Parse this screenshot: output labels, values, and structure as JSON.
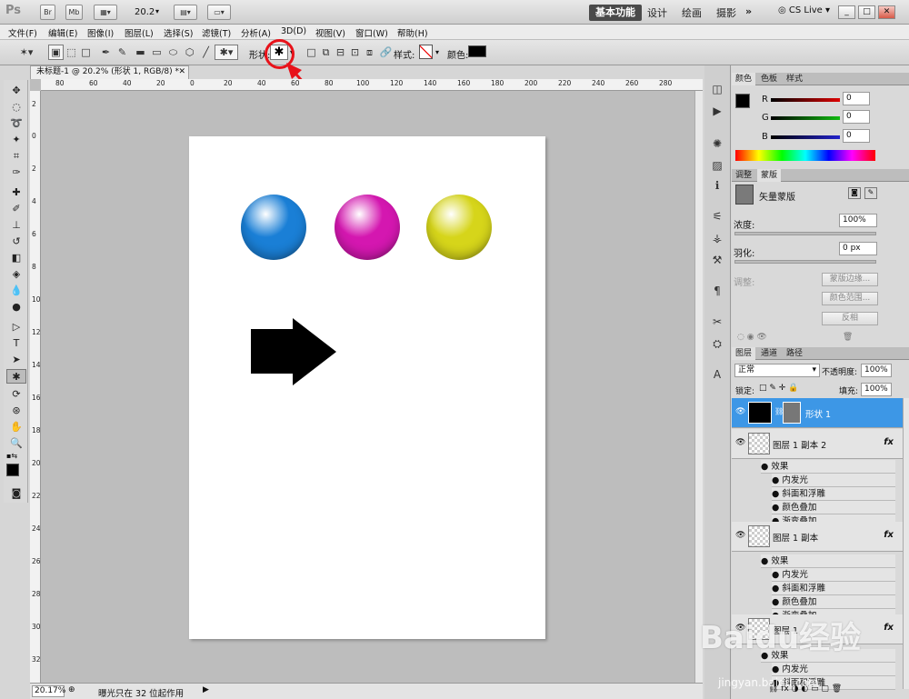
{
  "app": {
    "logo": "Ps",
    "bridge": "Br",
    "minibridge": "Mb",
    "zoom": "20.2"
  },
  "workspaces": [
    "基本功能",
    "设计",
    "绘画",
    "摄影"
  ],
  "cslive": "CS Live",
  "window_controls": [
    "_",
    "□",
    "✕"
  ],
  "menu": [
    "文件(F)",
    "编辑(E)",
    "图像(I)",
    "图层(L)",
    "选择(S)",
    "滤镜(T)",
    "分析(A)",
    "3D(D)",
    "视图(V)",
    "窗口(W)",
    "帮助(H)"
  ],
  "options": {
    "shape_label": "形状:",
    "style_label": "样式:",
    "color_label": "颜色:",
    "shape_glyph": "✱",
    "color": "#000000",
    "highlight_color": "#e8121a"
  },
  "document": {
    "tab": "未标题-1 @ 20.2% (形状 1, RGB/8) *",
    "ruler_h": [
      "80",
      "60",
      "40",
      "20",
      "0",
      "20",
      "40",
      "60",
      "80",
      "100",
      "120",
      "140",
      "160",
      "180",
      "200",
      "220",
      "240",
      "260",
      "280"
    ],
    "ruler_v": [
      "2",
      "0",
      "2",
      "4",
      "6",
      "8",
      "10",
      "12",
      "14",
      "16",
      "18",
      "20",
      "22",
      "24",
      "26",
      "28",
      "30",
      "32",
      "34"
    ],
    "zoom_field": "20.17%",
    "status": "曝光只在 32 位起作用"
  },
  "canvas": {
    "balls": [
      {
        "color": "#1a7fd6"
      },
      {
        "color": "#d417b0"
      },
      {
        "color": "#d6d51a"
      }
    ],
    "arrow_color": "#000000"
  },
  "color_panel": {
    "tabs": [
      "颜色",
      "色板",
      "样式"
    ],
    "channels": [
      {
        "label": "R",
        "value": "0"
      },
      {
        "label": "G",
        "value": "0"
      },
      {
        "label": "B",
        "value": "0"
      }
    ]
  },
  "mask_panel": {
    "tabs": [
      "调整",
      "蒙版"
    ],
    "title": "矢量蒙版",
    "density_label": "浓度:",
    "density_value": "100%",
    "feather_label": "羽化:",
    "feather_value": "0 px",
    "refine_label": "调整:",
    "buttons": [
      "蒙版边缘...",
      "颜色范围...",
      "反相"
    ]
  },
  "layers_panel": {
    "tabs": [
      "图层",
      "通道",
      "路径"
    ],
    "blend_mode": "正常",
    "opacity_label": "不透明度:",
    "opacity": "100%",
    "lock_label": "锁定:",
    "fill_label": "填充:",
    "fill": "100%",
    "layers": [
      {
        "name": "形状 1",
        "selected": true
      },
      {
        "name": "图层 1 副本 2",
        "fx": "fx",
        "effects_label": "效果",
        "effects": [
          "内发光",
          "斜面和浮雕",
          "颜色叠加",
          "渐变叠加"
        ]
      },
      {
        "name": "图层 1 副本",
        "fx": "fx",
        "effects_label": "效果",
        "effects": [
          "内发光",
          "斜面和浮雕",
          "颜色叠加",
          "渐变叠加"
        ]
      },
      {
        "name": "图层 1",
        "fx": "fx",
        "effects_label": "效果",
        "effects": [
          "内发光",
          "斜面和浮雕"
        ]
      }
    ]
  },
  "watermark": {
    "main": "Baidu经验",
    "sub": "jingyan.baidu.com"
  }
}
